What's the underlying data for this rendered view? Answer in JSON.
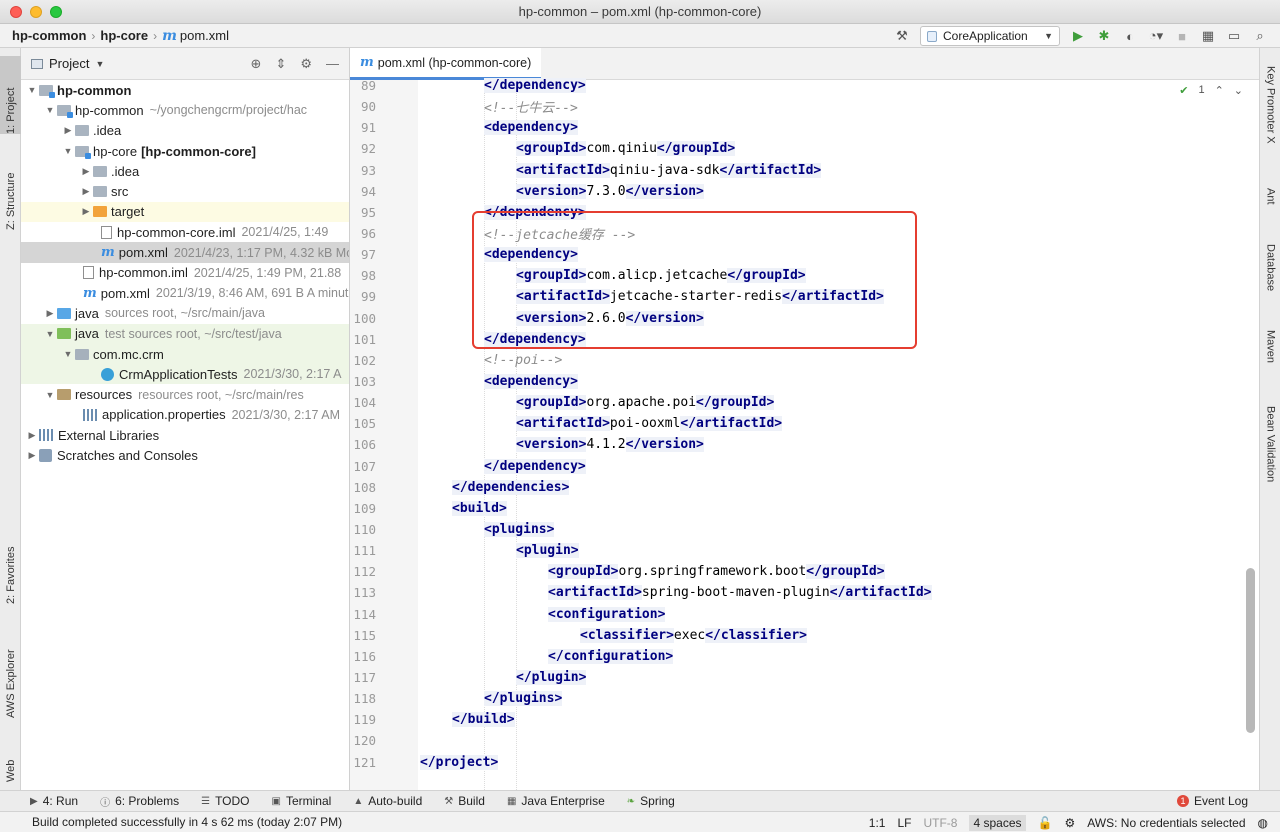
{
  "window": {
    "title": "hp-common – pom.xml (hp-common-core)"
  },
  "navbar": {
    "crumbs": [
      "hp-common",
      "hp-core",
      "pom.xml"
    ],
    "run_config": "CoreApplication"
  },
  "left_tools": [
    "1: Project",
    "Z: Structure",
    "2: Favorites",
    "AWS Explorer",
    "Web"
  ],
  "right_tools": [
    "Key Promoter X",
    "Ant",
    "Database",
    "Maven",
    "Bean Validation"
  ],
  "project": {
    "header": "Project",
    "tree": [
      {
        "label": "hp-common",
        "meta": ""
      },
      {
        "label": "hp-common",
        "meta": "~/yongchengcrm/project/hac"
      },
      {
        "label": ".idea",
        "meta": ""
      },
      {
        "label": "hp-core",
        "label_extra": "[hp-common-core]",
        "meta": ""
      },
      {
        "label": ".idea",
        "meta": ""
      },
      {
        "label": "src",
        "meta": ""
      },
      {
        "label": "target",
        "meta": ""
      },
      {
        "label": "hp-common-core.iml",
        "meta": "2021/4/25, 1:49"
      },
      {
        "label": "pom.xml",
        "meta": "2021/4/23, 1:17 PM, 4.32 kB Mo"
      },
      {
        "label": "hp-common.iml",
        "meta": "2021/4/25, 1:49 PM, 21.88"
      },
      {
        "label": "pom.xml",
        "meta": "2021/3/19, 8:46 AM, 691 B A minut"
      },
      {
        "label": "java",
        "meta": "sources root, ~/src/main/java"
      },
      {
        "label": "java",
        "meta": "test sources root, ~/src/test/java"
      },
      {
        "label": "com.mc.crm",
        "meta": ""
      },
      {
        "label": "CrmApplicationTests",
        "meta": "2021/3/30, 2:17 A"
      },
      {
        "label": "resources",
        "meta": "resources root, ~/src/main/res"
      },
      {
        "label": "application.properties",
        "meta": "2021/3/30, 2:17 AM"
      },
      {
        "label": "External Libraries",
        "meta": ""
      },
      {
        "label": "Scratches and Consoles",
        "meta": ""
      }
    ]
  },
  "editor": {
    "tab": "pom.xml (hp-common-core)",
    "inspection_count": "1",
    "lines": [
      {
        "n": "89",
        "t": "</dependency>"
      },
      {
        "n": "90",
        "t": "<!--七牛云-->"
      },
      {
        "n": "91",
        "t": "<dependency>"
      },
      {
        "n": "92",
        "t": "<groupId>com.qiniu</groupId>"
      },
      {
        "n": "93",
        "t": "<artifactId>qiniu-java-sdk</artifactId>"
      },
      {
        "n": "94",
        "t": "<version>7.3.0</version>"
      },
      {
        "n": "95",
        "t": "</dependency>"
      },
      {
        "n": "96",
        "t": "<!--jetcache缓存 -->"
      },
      {
        "n": "97",
        "t": "<dependency>"
      },
      {
        "n": "98",
        "t": "<groupId>com.alicp.jetcache</groupId>"
      },
      {
        "n": "99",
        "t": "<artifactId>jetcache-starter-redis</artifactId>"
      },
      {
        "n": "100",
        "t": "<version>2.6.0</version>"
      },
      {
        "n": "101",
        "t": "</dependency>"
      },
      {
        "n": "102",
        "t": "<!--poi-->"
      },
      {
        "n": "103",
        "t": "<dependency>"
      },
      {
        "n": "104",
        "t": "<groupId>org.apache.poi</groupId>"
      },
      {
        "n": "105",
        "t": "<artifactId>poi-ooxml</artifactId>"
      },
      {
        "n": "106",
        "t": "<version>4.1.2</version>"
      },
      {
        "n": "107",
        "t": "</dependency>"
      },
      {
        "n": "108",
        "t": "</dependencies>"
      },
      {
        "n": "109",
        "t": "<build>"
      },
      {
        "n": "110",
        "t": "<plugins>"
      },
      {
        "n": "111",
        "t": "<plugin>"
      },
      {
        "n": "112",
        "t": "<groupId>org.springframework.boot</groupId>"
      },
      {
        "n": "113",
        "t": "<artifactId>spring-boot-maven-plugin</artifactId>"
      },
      {
        "n": "114",
        "t": "<configuration>"
      },
      {
        "n": "115",
        "t": "<classifier>exec</classifier>"
      },
      {
        "n": "116",
        "t": "</configuration>"
      },
      {
        "n": "117",
        "t": "</plugin>"
      },
      {
        "n": "118",
        "t": "</plugins>"
      },
      {
        "n": "119",
        "t": "</build>"
      },
      {
        "n": "120",
        "t": ""
      },
      {
        "n": "121",
        "t": "</project>"
      }
    ]
  },
  "bottom_tools": [
    "4: Run",
    "6: Problems",
    "TODO",
    "Terminal",
    "Auto-build",
    "Build",
    "Java Enterprise",
    "Spring"
  ],
  "event_log": {
    "label": "Event Log",
    "count": "1"
  },
  "status": {
    "message": "Build completed successfully in 4 s 62 ms (today 2:07 PM)",
    "position": "1:1",
    "line_sep": "LF",
    "encoding": "UTF-8",
    "indent": "4 spaces",
    "aws": "AWS: No credentials selected"
  },
  "colors": {
    "accent": "#4a88d8",
    "highlight_box": "#e53d30",
    "tag": "#000080",
    "comment": "#8c8c8c"
  }
}
